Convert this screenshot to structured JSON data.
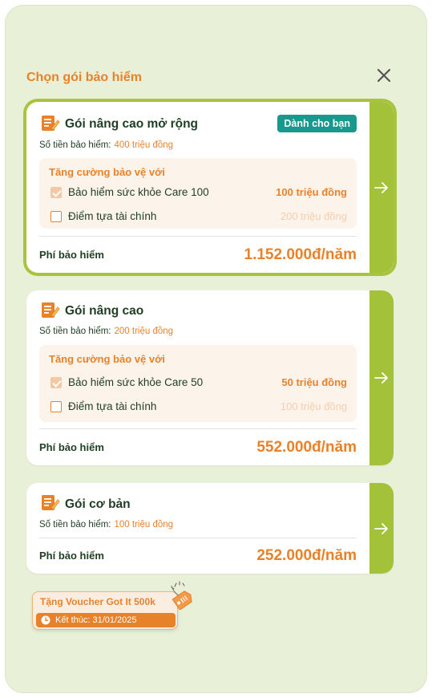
{
  "header": {
    "title": "Chọn gói bảo hiểm"
  },
  "plans": [
    {
      "name": "Gói nâng cao mở rộng",
      "badge": "Dành cho bạn",
      "sum_label": "Số tiền bảo hiểm:",
      "sum_value": "400 triệu đồng",
      "addon_title": "Tăng cường bảo vệ với",
      "addons": [
        {
          "label": "Bảo hiểm sức khỏe Care 100",
          "value": "100 triệu đồng",
          "checked": true
        },
        {
          "label": "Điểm tựa tài chính",
          "value": "200 triệu đồng",
          "checked": false
        }
      ],
      "fee_label": "Phí bảo hiểm",
      "fee_value": "1.152.000đ/năm",
      "selected": true
    },
    {
      "name": "Gói nâng cao",
      "sum_label": "Số tiền bảo hiểm:",
      "sum_value": "200 triệu đồng",
      "addon_title": "Tăng cường bảo vệ với",
      "addons": [
        {
          "label": "Bảo hiểm sức khỏe Care 50",
          "value": "50 triệu đồng",
          "checked": true
        },
        {
          "label": "Điểm tựa tài chính",
          "value": "100 triệu đồng",
          "checked": false
        }
      ],
      "fee_label": "Phí bảo hiểm",
      "fee_value": "552.000đ/năm",
      "selected": false
    },
    {
      "name": "Gói cơ bản",
      "sum_label": "Số tiền bảo hiểm:",
      "sum_value": "100 triệu đồng",
      "fee_label": "Phí bảo hiểm",
      "fee_value": "252.000đ/năm",
      "selected": false
    }
  ],
  "voucher": {
    "title": "Tặng Voucher Got It 500k",
    "expiry": "Kết thúc: 31/01/2025"
  },
  "colors": {
    "accent_orange": "#e8822a",
    "accent_green": "#a4c13a",
    "badge_teal": "#17998e",
    "text_dark_green": "#1f3d22",
    "sheet_background": "#e9f0d8"
  },
  "icons": [
    "close-icon",
    "document-pen-icon",
    "arrow-right-icon",
    "clock-icon",
    "voucher-tag-icon"
  ]
}
